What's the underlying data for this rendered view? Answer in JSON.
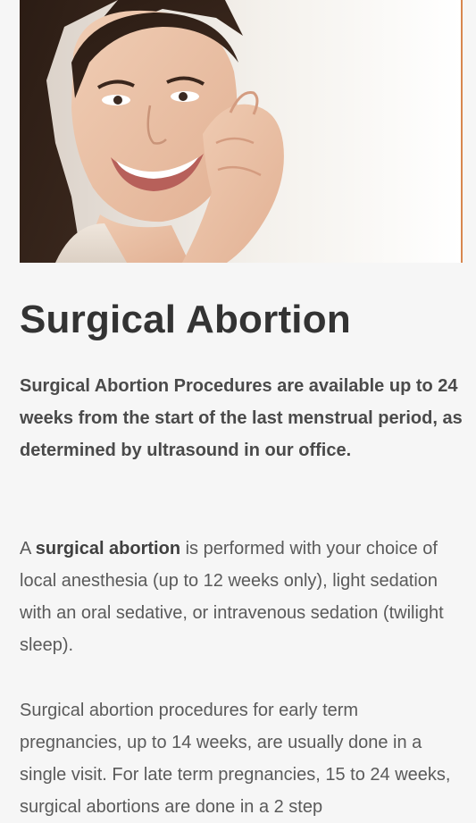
{
  "hero": {
    "image_subject": "smiling-woman-portrait"
  },
  "heading": {
    "title": "Surgical Abortion"
  },
  "intro": {
    "lead": "Surgical Abortion Procedures are available up to 24 weeks from the start of the last menstrual period, as determined by ultrasound in our office."
  },
  "paragraph1": {
    "prefix": "A ",
    "bold_term": "surgical abortion",
    "rest": " is performed with your choice of local anesthesia (up to 12 weeks only), light sedation with an oral sedative, or intravenous sedation (twilight sleep)."
  },
  "paragraph2": {
    "text": "Surgical abortion procedures for early term pregnancies, up to 14 weeks, are usually done in a single visit. For late term pregnancies, 15 to 24 weeks, surgical abortions are done in a 2 step"
  },
  "colors": {
    "background": "#f6f6f6",
    "heading": "#333333",
    "body_text": "#5a5a5a"
  }
}
